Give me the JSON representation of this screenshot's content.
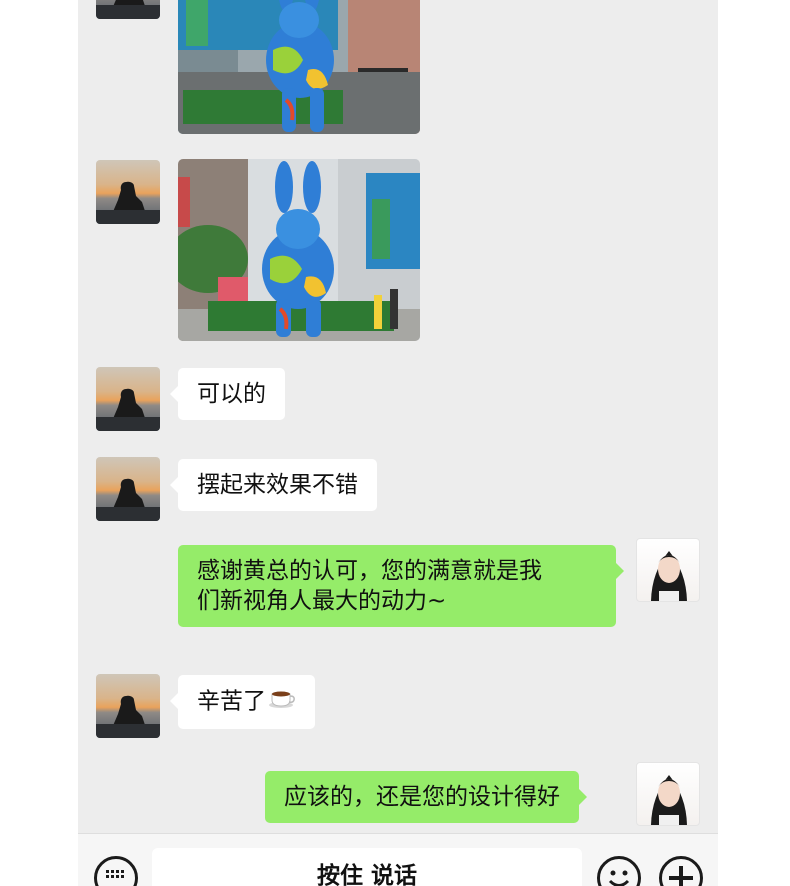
{
  "messages": [
    {
      "side": "left",
      "type": "image",
      "subject": "blue-green-painted-rabbit-sculpture-street-view-1"
    },
    {
      "side": "left",
      "type": "image",
      "subject": "blue-green-painted-rabbit-sculpture-street-view-2"
    },
    {
      "side": "left",
      "type": "text",
      "text": "可以的"
    },
    {
      "side": "left",
      "type": "text",
      "text": "摆起来效果不错"
    },
    {
      "side": "right",
      "type": "text",
      "line1": "感谢黄总的认可，您的满意就是我",
      "line2": "们新视角人最大的动力~"
    },
    {
      "side": "left",
      "type": "text",
      "text": "辛苦了",
      "emoji": "coffee-cup"
    },
    {
      "side": "right",
      "type": "text",
      "text": "应该的，还是您的设计得好"
    }
  ],
  "inputbar": {
    "hold_to_talk": "按住 说话",
    "left_icon": "keyboard-icon",
    "right_icons": [
      "emoji-icon",
      "plus-icon"
    ]
  },
  "colors": {
    "chat_bg": "#ededed",
    "left_bubble": "#ffffff",
    "right_bubble": "#95ec69"
  }
}
